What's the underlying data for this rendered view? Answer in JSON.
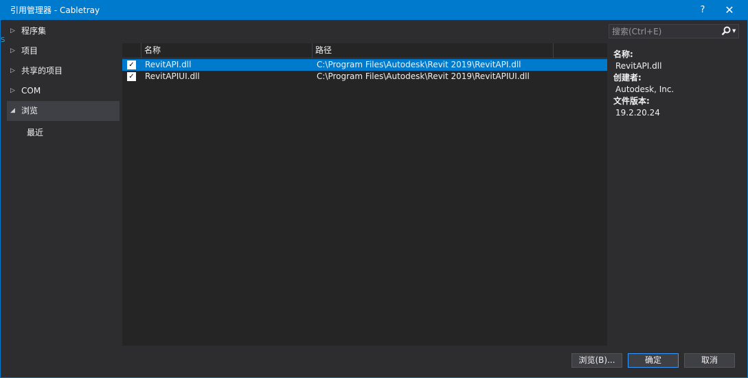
{
  "window": {
    "title": "引用管理器 - Cabletray",
    "help_label": "?",
    "close_label": "✕",
    "edge_mark": "S"
  },
  "sidebar": {
    "items": [
      {
        "label": "程序集",
        "expanded": false
      },
      {
        "label": "项目",
        "expanded": false
      },
      {
        "label": "共享的项目",
        "expanded": false
      },
      {
        "label": "COM",
        "expanded": false
      },
      {
        "label": "浏览",
        "expanded": true,
        "selected": true
      }
    ],
    "sub_items": [
      {
        "label": "最近"
      }
    ]
  },
  "list": {
    "columns": [
      "名称",
      "路径"
    ],
    "rows": [
      {
        "checked": true,
        "name": "RevitAPI.dll",
        "path": "C:\\Program Files\\Autodesk\\Revit 2019\\RevitAPI.dll",
        "selected": true
      },
      {
        "checked": true,
        "name": "RevitAPIUI.dll",
        "path": "C:\\Program Files\\Autodesk\\Revit 2019\\RevitAPIUI.dll",
        "selected": false
      }
    ]
  },
  "search": {
    "placeholder": "搜索(Ctrl+E)",
    "icon": "search-icon"
  },
  "details": {
    "name_label": "名称:",
    "name_value": "RevitAPI.dll",
    "creator_label": "创建者:",
    "creator_value": "Autodesk, Inc.",
    "version_label": "文件版本:",
    "version_value": "19.2.20.24"
  },
  "buttons": {
    "browse": "浏览(B)...",
    "ok": "确定",
    "cancel": "取消"
  },
  "colors": {
    "accent": "#007acc",
    "background": "#2d2d30",
    "list_background": "#252526"
  }
}
